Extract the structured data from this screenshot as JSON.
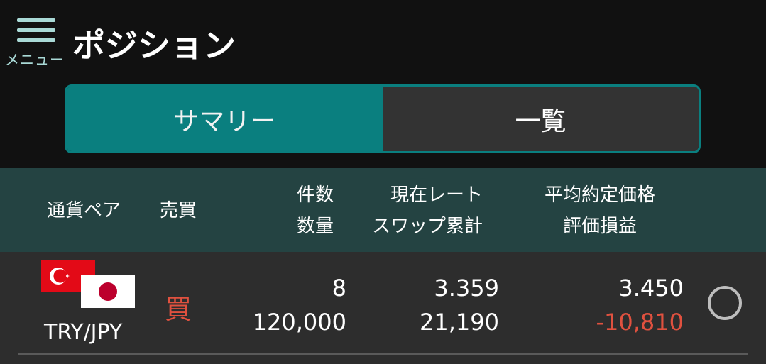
{
  "header": {
    "menu_label": "メニュー",
    "title": "ポジション"
  },
  "tabs": [
    {
      "label": "サマリー",
      "active": true
    },
    {
      "label": "一覧",
      "active": false
    }
  ],
  "columns": {
    "pair": "通貨ペア",
    "side": "売買",
    "count": "件数",
    "quantity": "数量",
    "current_rate": "現在レート",
    "swap_total": "スワップ累計",
    "avg_price": "平均約定価格",
    "pnl": "評価損益"
  },
  "positions": [
    {
      "pair": "TRY/JPY",
      "side": "買",
      "count": "8",
      "quantity": "120,000",
      "current_rate": "3.359",
      "swap_total": "21,190",
      "avg_price": "3.450",
      "pnl": "-10,810"
    }
  ],
  "colors": {
    "accent": "#0a7f7f",
    "header_bg": "#244342",
    "buy": "#e0513f",
    "negative": "#e0513f",
    "menu_icon": "#a9d9d6"
  },
  "icons": {
    "menu": "hamburger-icon",
    "flag_base": "turkey-flag-icon",
    "flag_quote": "japan-flag-icon",
    "select": "radio-circle-icon"
  }
}
